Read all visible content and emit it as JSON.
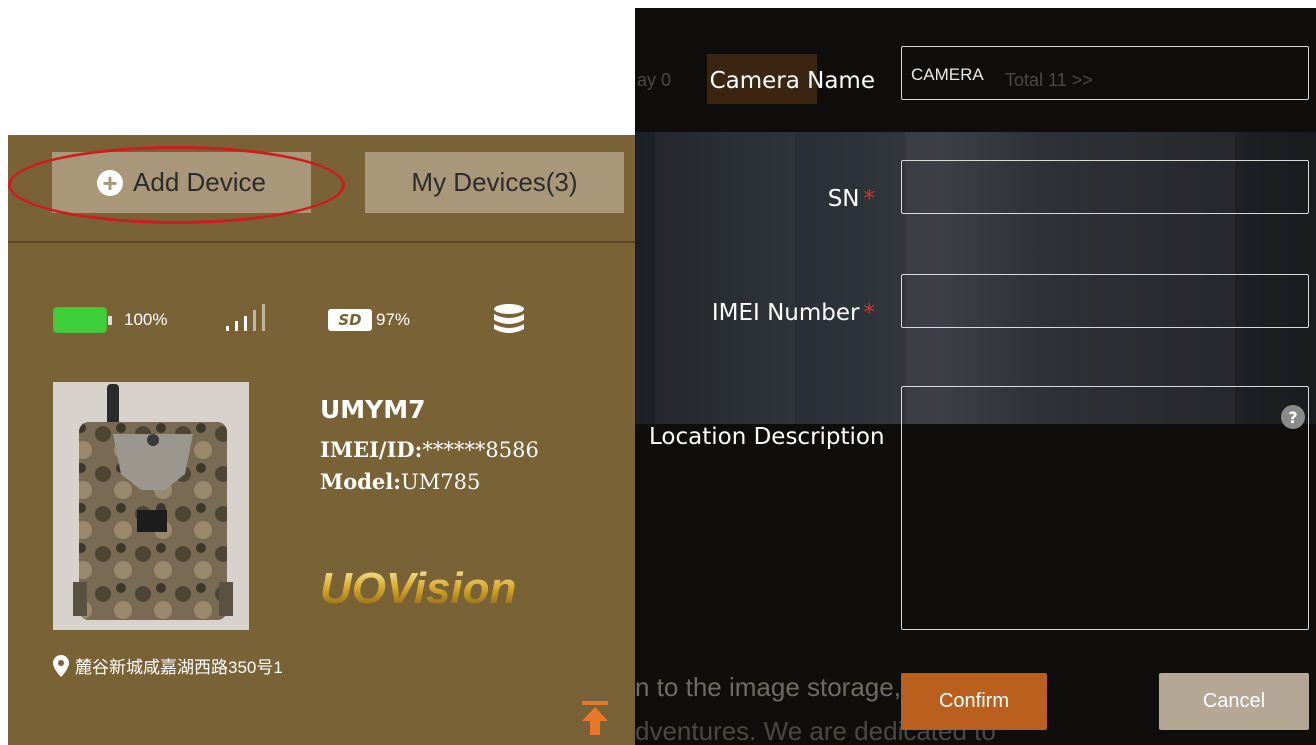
{
  "left_panel": {
    "add_device_label": "Add Device",
    "my_devices_label": "My Devices(3)",
    "status": {
      "battery_percent": "100%",
      "battery_level": 1.0,
      "signal_bars": 5,
      "sd_label": "SD",
      "sd_percent": "97%"
    },
    "device": {
      "name": "UMYM7",
      "imei_label": "IMEI/ID:",
      "imei_value": "******8586",
      "model_label": "Model:",
      "model_value": "UM785",
      "brand": "UOVision"
    },
    "location": "麓谷新城咸嘉湖西路350号1"
  },
  "dialog": {
    "camera_name_label": "Camera Name",
    "camera_name_value": "CAMERA",
    "sn_label": "SN",
    "imei_number_label": "IMEI Number",
    "required_mark": "*",
    "location_description_label": "Location Description",
    "help_label": "?",
    "confirm_label": "Confirm",
    "cancel_label": "Cancel"
  },
  "background_text": {
    "line1": "n to the image storage,",
    "line2": "dventures. We are dedicated to",
    "nav_left": "ay 0",
    "nav_right": "Total 11 >>"
  },
  "colors": {
    "panel_brown": "#7a6237",
    "tab_tan": "#a9977a",
    "highlight_red": "#d01c1c",
    "battery_green": "#3ecf3a",
    "confirm_orange": "#b9601e",
    "cancel_tan": "#b4a796",
    "required_red": "#e0302e"
  }
}
